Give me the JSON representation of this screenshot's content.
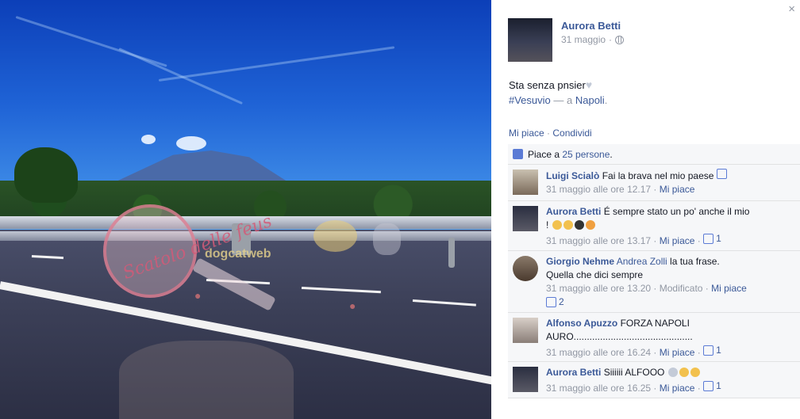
{
  "post": {
    "author": "Aurora Betti",
    "date": "31 maggio",
    "separator": " · ",
    "text": "Sta senza pnsier",
    "hashtag": "#Vesuvio",
    "location_sep": " — a ",
    "location": "Napoli",
    "location_end": ".",
    "like_label": "Mi piace",
    "action_sep": " · ",
    "share_label": "Condividi",
    "likes_prefix": "Piace a ",
    "likes_count": "25 persone",
    "likes_suffix": "."
  },
  "close_symbol": "×",
  "comments": [
    {
      "author": "Luigi Scialò",
      "text": "Fai la brava nel mio paese",
      "time": "31 maggio alle ore 12.17",
      "like_label": "Mi piace",
      "likes": "",
      "avatar_color": "#7a6a5a",
      "emojis": [
        "thumb-icon"
      ]
    },
    {
      "author": "Aurora Betti",
      "text": "É sempre stato un po' anche il mio",
      "text2": "!",
      "time": "31 maggio alle ore 13.17",
      "like_label": "Mi piace",
      "likes": "1",
      "avatar_color": "#2a2e40",
      "emojis": [
        "fist-icon",
        "rock-icon",
        "bomb-icon",
        "party-icon"
      ]
    },
    {
      "author": "Giorgio Nehme",
      "mention": "Andrea Zolli",
      "text": " la tua frase.",
      "text2": "Quella che dici sempre",
      "time": "31 maggio alle ore 13.20",
      "edited": "Modificato",
      "like_label": "Mi piace",
      "likes": "2",
      "avatar_color": "#5a4a3e"
    },
    {
      "author": "Alfonso Apuzzo",
      "text": "FORZA NAPOLI",
      "text2": "AURO.............................................",
      "time": "31 maggio alle ore 16.24",
      "like_label": "Mi piace",
      "likes": "1",
      "avatar_color": "#b5a8a0"
    },
    {
      "author": "Aurora Betti",
      "text": "Siiiiii ALFOOO",
      "time": "31 maggio alle ore 16.25",
      "like_label": "Mi piace",
      "likes": "1",
      "avatar_color": "#2a2e40",
      "emojis": [
        "heart-icon",
        "laugh-icon",
        "grin-icon"
      ]
    }
  ],
  "watermark": {
    "text": "Scatolo delle feus",
    "site": "dogcatweb"
  },
  "colors": {
    "link": "#3b5998",
    "muted": "#9197a3",
    "comment_bg": "#f6f7f9"
  }
}
